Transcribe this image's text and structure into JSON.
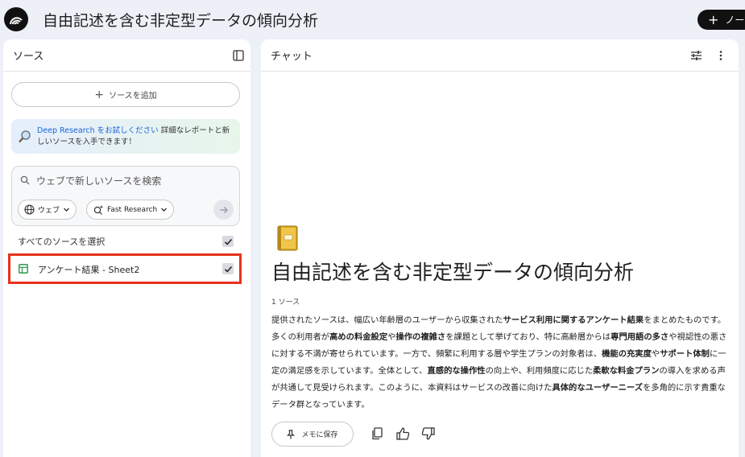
{
  "app": {
    "title": "自由記述を含む非定型データの傾向分析",
    "logo_icon": "notebooklm-logo-icon",
    "new_note_label": "ノート"
  },
  "sources_panel": {
    "title": "ソース",
    "toggle_icon": "panel-toggle-icon",
    "add_source_label": "ソースを追加",
    "promo": {
      "link_text": "Deep Research をお試しください",
      "text_inline": "詳細なレポートと新",
      "text_line2": "しいソースを入手できます！"
    },
    "search": {
      "placeholder": "ウェブで新しいソースを検索",
      "web_chip_label": "ウェブ",
      "research_chip_label": "Fast Research"
    },
    "select_all_label": "すべてのソースを選択",
    "items": [
      {
        "name": "アンケート結果 - Sheet2",
        "icon": "sheet-icon",
        "checked": true
      }
    ]
  },
  "chat_panel": {
    "title": "チャット",
    "notebook_title": "自由記述を含む非定型データの傾向分析",
    "source_count": "1 ソース",
    "summary": {
      "p1": "提供されたソースは、幅広い年齢層のユーザーから収集された",
      "b1": "サービス利用に関するアンケート結果",
      "p2": "をまとめたものです。多くの利用者が",
      "b2": "高めの料金設定",
      "p3": "や",
      "b3": "操作の複雑さ",
      "p4": "を課題として挙げており、特に高齢層からは",
      "b4": "専門用語の多さ",
      "p5": "や視認性の悪さに対する不満が寄せられています。一方で、頻繁に利用する層や学生プランの対象者は、",
      "b5": "機能の充実度",
      "p6": "や",
      "b6": "サポート体制",
      "p7": "に一定の満足感を示しています。全体として、",
      "b7": "直感的な操作性",
      "p8": "の向上や、利用頻度に応じた",
      "b8": "柔軟な料金プラン",
      "p9": "の導入を求める声が共通して見受けられます。このように、本資料はサービスの改善に向けた",
      "b9": "具体的なユーザーニーズ",
      "p10": "を多角的に示す貴重なデータ群となっています。"
    },
    "save_note_label": "メモに保存"
  },
  "colors": {
    "background": "#eef0f8",
    "panel": "#ffffff",
    "highlight_border": "#e8321d",
    "link": "#1a63d8"
  }
}
